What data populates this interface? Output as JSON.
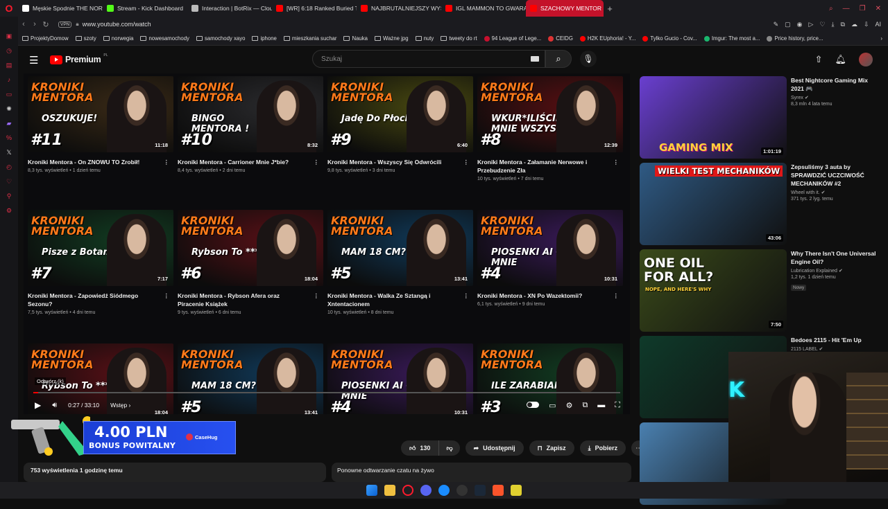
{
  "browser": {
    "tabs": [
      {
        "label": "Męskie Spodnie THE NORT",
        "color": "#ffffff"
      },
      {
        "label": "Stream - Kick Dashboard",
        "color": "#53fc18"
      },
      {
        "label": "Interaction | BotRix — Clou",
        "color": "#bbbbbb"
      },
      {
        "label": "[WR] 6:18 Ranked Buried T",
        "color": "#ff0000"
      },
      {
        "label": "NAJBRUTALNIEJSZY WYS",
        "color": "#ff0000"
      },
      {
        "label": "IGL MAMMON TO GWARA",
        "color": "#ff0000"
      },
      {
        "label": "SZACHOWY MENTOR I",
        "color": "#ff0000",
        "active": true
      }
    ],
    "url": "www.youtube.com/watch",
    "vpn_label": "VPN",
    "ai_label": "AI",
    "bookmarks": [
      {
        "label": "ProjektyDomow",
        "type": "folder"
      },
      {
        "label": "szoty",
        "type": "folder"
      },
      {
        "label": "norwegia",
        "type": "folder"
      },
      {
        "label": "nowesamochody",
        "type": "folder"
      },
      {
        "label": "samochody xayo",
        "type": "folder"
      },
      {
        "label": "iphone",
        "type": "folder"
      },
      {
        "label": "mieszkania suchar",
        "type": "folder"
      },
      {
        "label": "Nauka",
        "type": "folder"
      },
      {
        "label": "Ważne jpg",
        "type": "folder"
      },
      {
        "label": "nuty",
        "type": "folder"
      },
      {
        "label": "tweety do rt",
        "type": "folder"
      },
      {
        "label": "94 League of Lege...",
        "type": "site",
        "color": "#c8102e"
      },
      {
        "label": "CEIDG",
        "type": "site",
        "color": "#d33"
      },
      {
        "label": "H2K EUphoria! - Y...",
        "type": "site",
        "color": "#f00"
      },
      {
        "label": "Tylko Gucio - Cov...",
        "type": "site",
        "color": "#f00"
      },
      {
        "label": "Imgur: The most a...",
        "type": "site",
        "color": "#1bb76e"
      },
      {
        "label": "Price history, price...",
        "type": "site",
        "color": "#888"
      }
    ]
  },
  "youtube": {
    "brand": "Premium",
    "brand_region": "PL",
    "search_placeholder": "Szukaj",
    "endscreen": [
      {
        "thumb_title": "KRONIKI MENTORA",
        "thumb_sub": "OSZUKUJE!",
        "thumb_num": "#11",
        "duration": "11:18",
        "title": "Kroniki Mentora - On ZNOWU TO Zrobił!",
        "meta": "8,3 tys. wyświetleń • 1 dzień temu",
        "bg": "#3a2a16"
      },
      {
        "thumb_title": "KRONIKI MENTORA",
        "thumb_sub": "BINGO MENTORA !",
        "thumb_num": "#10",
        "duration": "8:32",
        "title": "Kroniki Mentora - Carrioner Mnie J*bie?",
        "meta": "8,4 tys. wyświetleń • 2 dni temu",
        "bg": "#2b2b2e"
      },
      {
        "thumb_title": "KRONIKI MENTORA",
        "thumb_sub": "Jadę Do Płocka",
        "thumb_num": "#9",
        "duration": "6:40",
        "title": "Kroniki Mentora - Wszyscy Się Odwrócili",
        "meta": "9,8 tys. wyświetleń • 3 dni temu",
        "bg": "#4a4a10"
      },
      {
        "thumb_title": "KRONIKI MENTORA",
        "thumb_sub": "WKUR*ILIŚCIE MNIE WSZYSCY",
        "thumb_num": "#8",
        "duration": "12:39",
        "title": "Kroniki Mentora - Załamanie Nerwowe i Przebudzenie Zła",
        "meta": "10 tys. wyświetleń • 7 dni temu",
        "bg": "#5a0f12"
      },
      {
        "thumb_title": "KRONIKI MENTORA",
        "thumb_sub": "Pisze z Botami?",
        "thumb_num": "#7",
        "duration": "7:17",
        "title": "Kroniki Mentora - Zapowiedź Siódmego Sezonu?",
        "meta": "7,5 tys. wyświetleń • 4 dni temu",
        "bg": "#123d22"
      },
      {
        "thumb_title": "KRONIKI MENTORA",
        "thumb_sub": "Rybson To ****?",
        "thumb_num": "#6",
        "duration": "18:04",
        "title": "Kroniki Mentora - Rybson Afera oraz Piracenie Książek",
        "meta": "9 tys. wyświetleń • 6 dni temu",
        "bg": "#5a1016"
      },
      {
        "thumb_title": "KRONIKI MENTORA",
        "thumb_sub": "MAM 18 CM?",
        "thumb_num": "#5",
        "duration": "13:41",
        "title": "Kroniki Mentora - Walka Ze Sztangą i Xntentacionem",
        "meta": "10 tys. wyświetleń • 8 dni temu",
        "bg": "#103a5a"
      },
      {
        "thumb_title": "KRONIKI MENTORA",
        "thumb_sub": "PIOSENKI AI O MNIE",
        "thumb_num": "#4",
        "duration": "10:31",
        "title": "Kroniki Mentora - XN Po Wazektomii?",
        "meta": "6,1 tys. wyświetleń • 9 dni temu",
        "bg": "#3a1a5a"
      },
      {
        "thumb_title": "KRONIKI MENTORA",
        "thumb_sub": "Rybson To ****?",
        "thumb_num": "",
        "duration": "18:04",
        "bg": "#5a1016"
      },
      {
        "thumb_title": "KRONIKI MENTORA",
        "thumb_sub": "MAM 18 CM?",
        "thumb_num": "#5",
        "duration": "13:41",
        "bg": "#103a5a"
      },
      {
        "thumb_title": "KRONIKI MENTORA",
        "thumb_sub": "PIOSENKI AI O MNIE",
        "thumb_num": "#4",
        "duration": "10:31",
        "bg": "#3a1a5a"
      },
      {
        "thumb_title": "KRONIKI MENTORA",
        "thumb_sub": "ILE ZARABIAM?",
        "thumb_num": "#3",
        "duration": "",
        "bg": "#123d22"
      }
    ],
    "player": {
      "tooltip": "Odtwórz (k)",
      "time": "0:27 / 33:10",
      "chapter": "Wstęp",
      "progress_fraction": 0.008
    },
    "ad": {
      "amount": "4.00 PLN",
      "bonus": "BONUS POWITALNY",
      "brand": "CaseHug"
    },
    "actions": {
      "likes": "130",
      "share": "Udostępnij",
      "save": "Zapisz",
      "download": "Pobierz"
    },
    "description": "753 wyświetlenia  1 godzinę temu",
    "chat_replay": "Ponowne odtwarzanie czatu na żywo",
    "recommendations": [
      {
        "title": "Best Nightcore Gaming Mix 2021 🎮",
        "channel": "Syrex",
        "meta": "8,3 mln  4 lata temu",
        "duration": "1:01:19",
        "overlay": "GAMING MIX",
        "bg": "#6a3fd0"
      },
      {
        "title": "Zepsuliśmy 3 auta by SPRAWDZIĆ UCZCIWOŚĆ MECHANIKÓW #2",
        "channel": "Wheel with it.",
        "meta": "371 tys.  2 lyg. temu",
        "duration": "43:06",
        "overlay": "WIELKI TEST MECHANIKÓW",
        "bg": "#2f5a84"
      },
      {
        "title": "Why There Isn't One Universal Engine Oil?",
        "channel": "Lubrication Explained",
        "meta": "1,2 tys.  1 dzień temu",
        "badge": "Nowy",
        "duration": "7:50",
        "overlay": "ONE OIL FOR ALL?",
        "overlay2": "NOPE, AND HERE'S WHY",
        "bg": "#3a4a1a"
      },
      {
        "title": "Bedoes 2115 - Hit 'Em Up",
        "channel": "2115 LABEL",
        "meta": "",
        "duration": "",
        "overlay": "",
        "bg": "#0f3a2a"
      },
      {
        "title": "",
        "channel": "",
        "meta": "",
        "duration": "",
        "overlay": "",
        "bg": "#4a80b0"
      }
    ]
  }
}
